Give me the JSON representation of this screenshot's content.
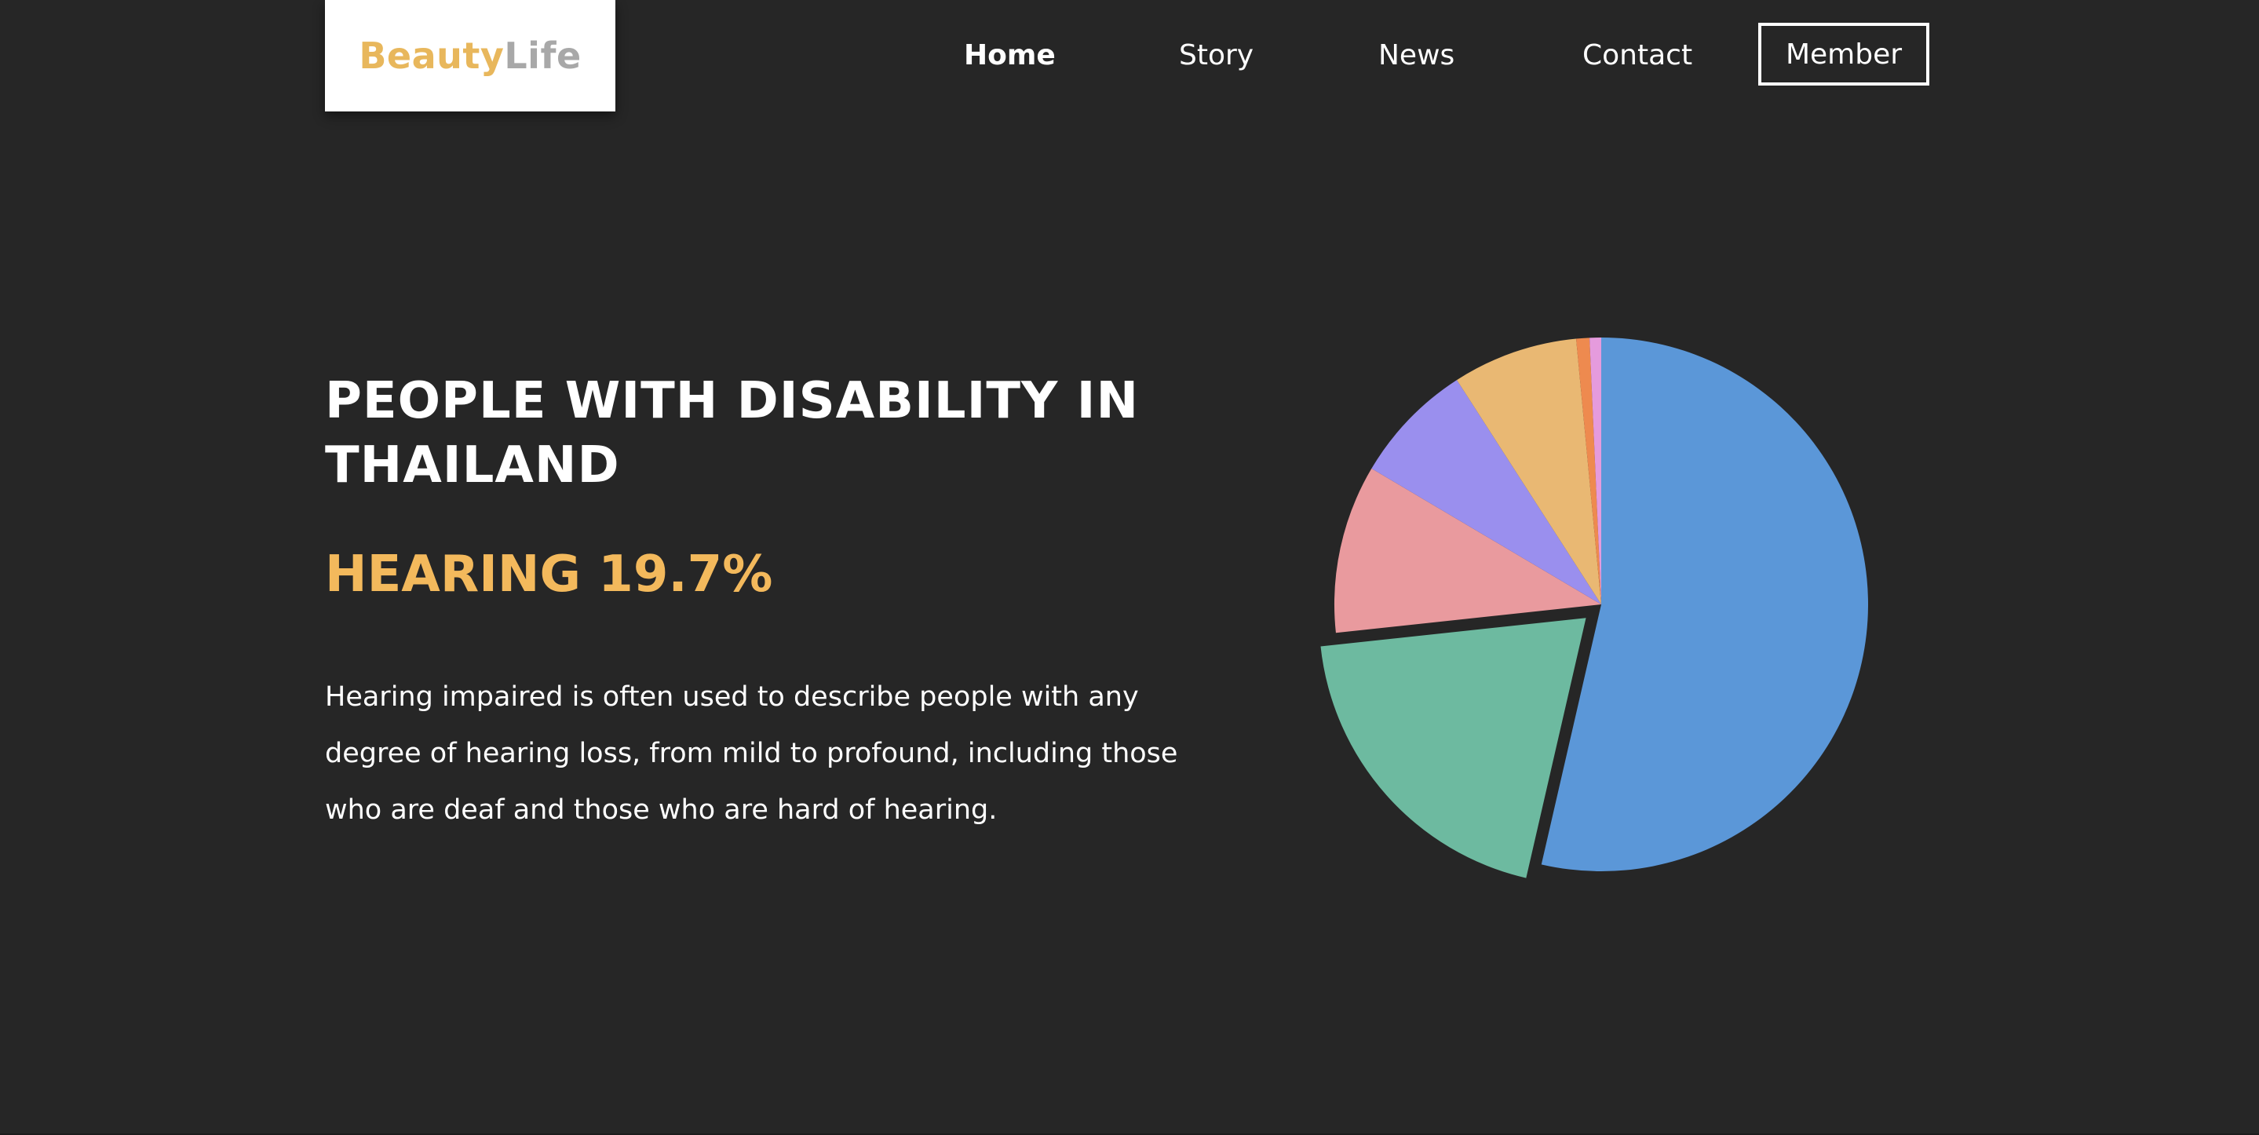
{
  "brand": {
    "name_part1": "Beauty",
    "name_part2": "Life",
    "color_part1": "#e8b75c",
    "color_part2": "#a8a8a8"
  },
  "nav": {
    "items": [
      {
        "label": "Home",
        "active": true
      },
      {
        "label": "Story",
        "active": false
      },
      {
        "label": "News",
        "active": false
      },
      {
        "label": "Contact",
        "active": false
      }
    ],
    "member_label": "Member"
  },
  "hero": {
    "title": "PEOPLE WITH DISABILITY IN THAILAND",
    "highlight": "HEARING 19.7%",
    "highlight_color": "#f3b95c",
    "description": "Hearing impaired is often used to describe people with any degree of hearing loss, from mild to profound, including those who are deaf and those who are hard of hearing."
  },
  "chart_data": {
    "type": "pie",
    "start_angle_deg": 0,
    "direction": "clockwise",
    "exploded_slice": 1,
    "slices": [
      {
        "value": 53.6,
        "color": "#5b97d8"
      },
      {
        "value": 19.7,
        "color": "#6dbaa0"
      },
      {
        "value": 10.2,
        "color": "#e99a9e"
      },
      {
        "value": 7.4,
        "color": "#9a8fee"
      },
      {
        "value": 7.6,
        "color": "#e9b873"
      },
      {
        "value": 0.8,
        "color": "#ee8a4f"
      },
      {
        "value": 0.7,
        "color": "#e59bdd"
      }
    ],
    "background": "#262626"
  }
}
